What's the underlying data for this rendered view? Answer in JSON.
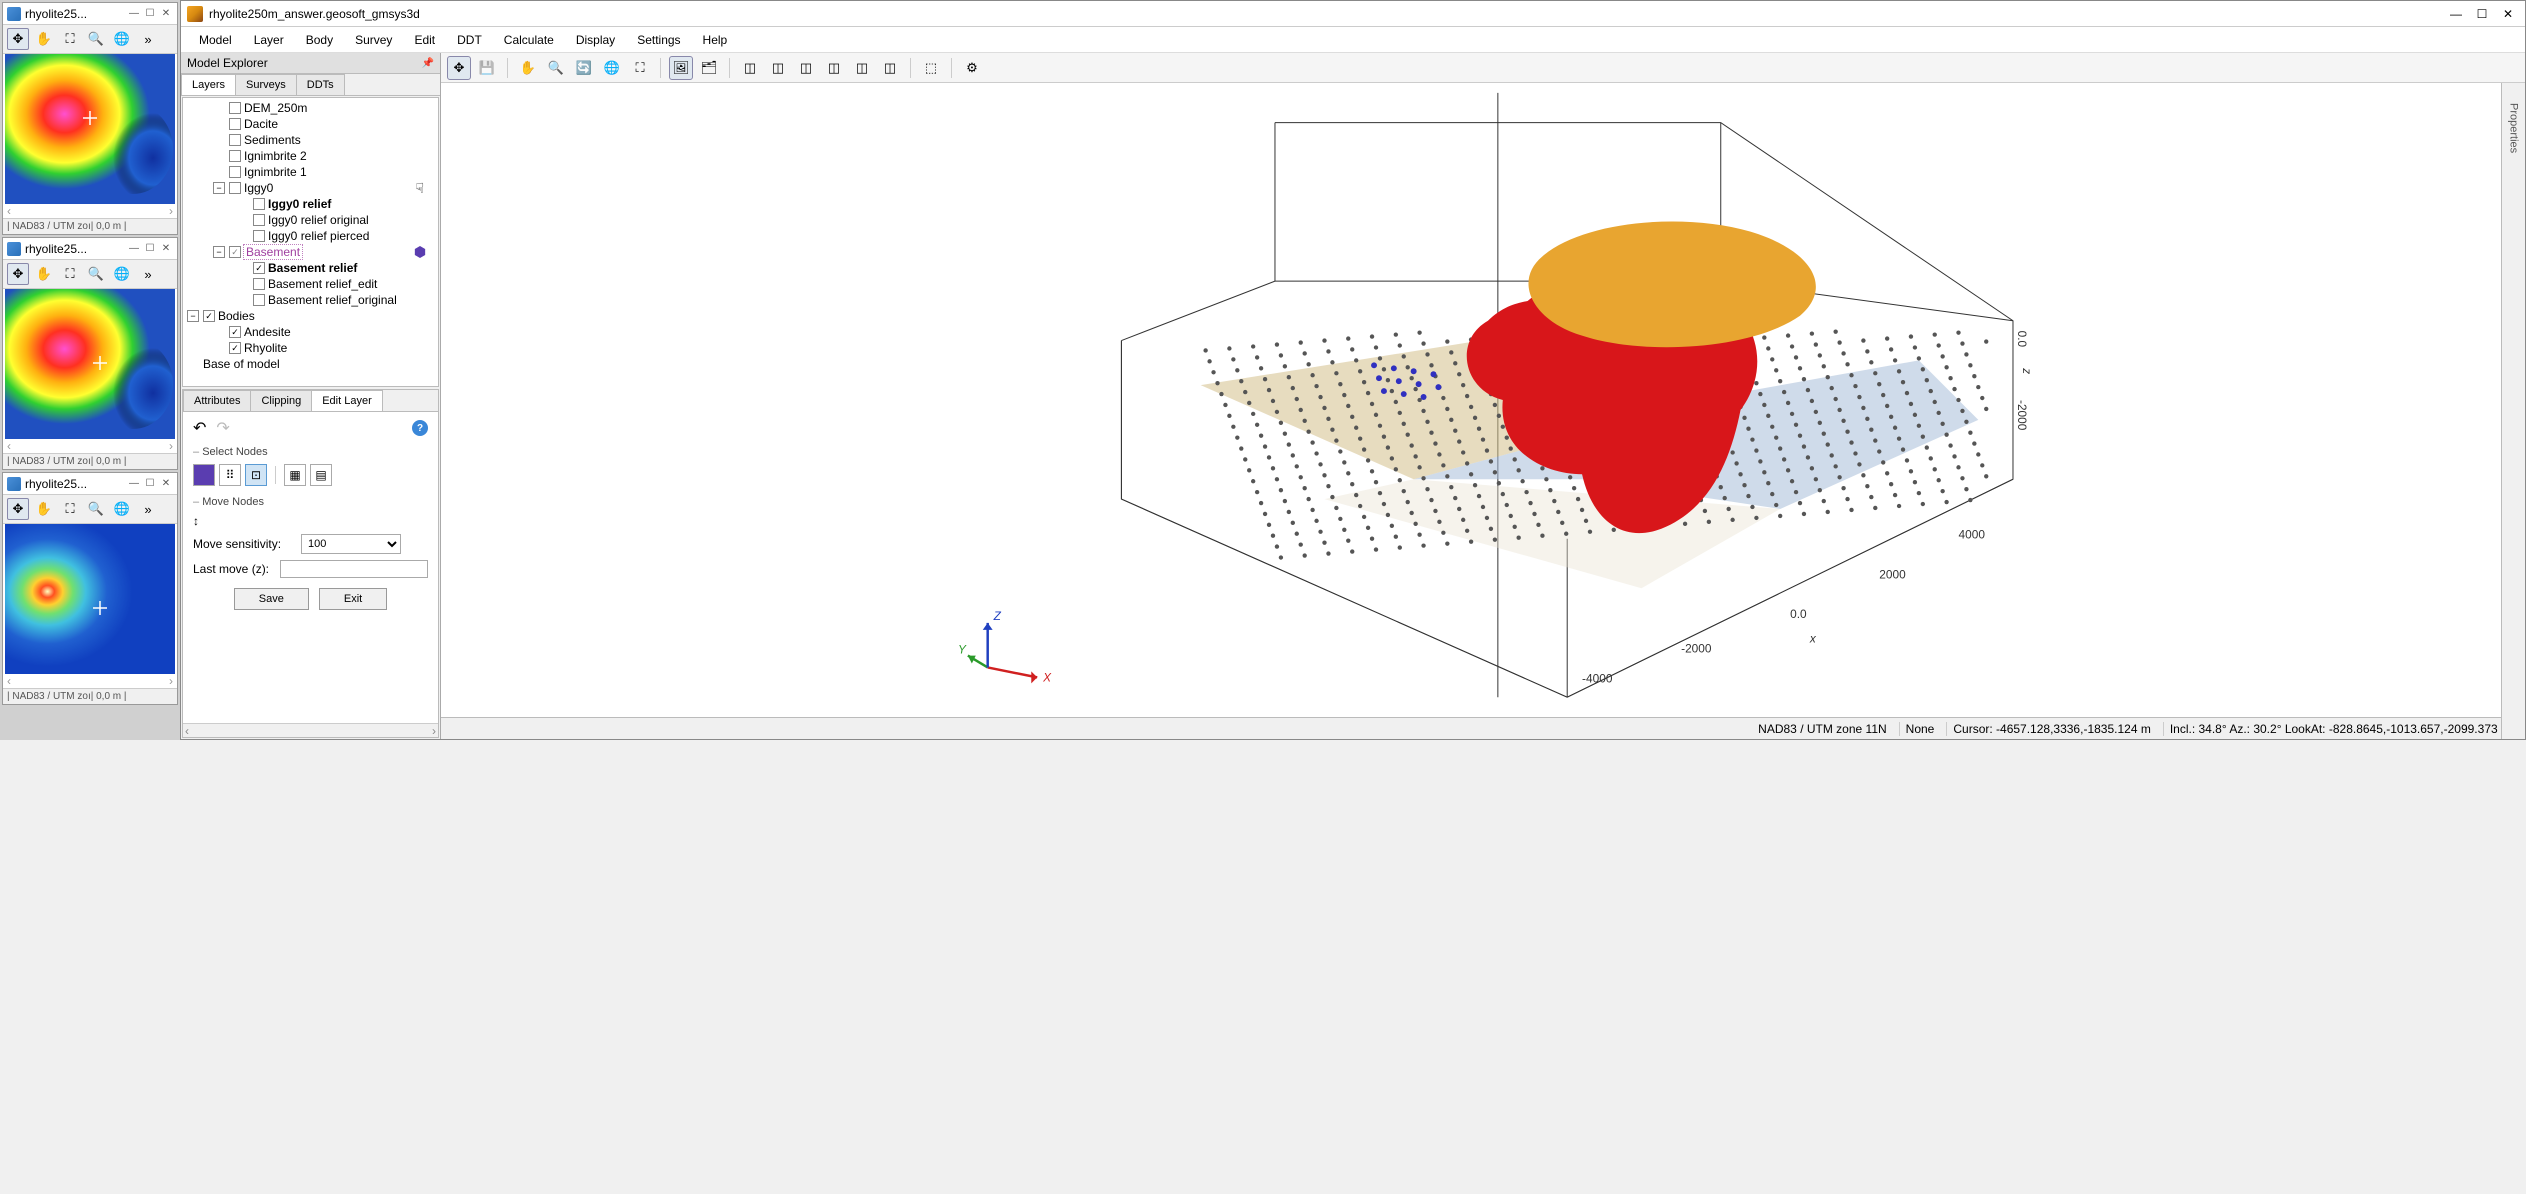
{
  "sidepanel": {
    "windows": [
      {
        "title": "rhyolite25...",
        "status": "| NAD83 / UTM zoı| 0,0 m |",
        "maptype": "rainbow"
      },
      {
        "title": "rhyolite25...",
        "status": "| NAD83 / UTM zoı| 0,0 m |",
        "maptype": "rainbow"
      },
      {
        "title": "rhyolite25...",
        "status": "| NAD83 / UTM zoı| 0,0 m |",
        "maptype": "bluespot"
      }
    ]
  },
  "main": {
    "title": "rhyolite250m_answer.geosoft_gmsys3d",
    "menu": [
      "Model",
      "Layer",
      "Body",
      "Survey",
      "Edit",
      "DDT",
      "Calculate",
      "Display",
      "Settings",
      "Help"
    ]
  },
  "explorer": {
    "header": "Model Explorer",
    "tabs": [
      "Layers",
      "Surveys",
      "DDTs"
    ],
    "activeTab": 0,
    "tree": {
      "dem": "DEM_250m",
      "dacite": "Dacite",
      "sediments": "Sediments",
      "ign2": "Ignimbrite 2",
      "ign1": "Ignimbrite 1",
      "iggy0": "Iggy0",
      "iggy0_relief": "Iggy0 relief",
      "iggy0_orig": "Iggy0 relief original",
      "iggy0_pierced": "Iggy0 relief pierced",
      "basement": "Basement",
      "basement_relief": "Basement relief",
      "basement_edit": "Basement relief_edit",
      "basement_orig": "Basement relief_original",
      "bodies": "Bodies",
      "andesite": "Andesite",
      "rhyolite": "Rhyolite",
      "base": "Base of model"
    }
  },
  "lower": {
    "tabs": [
      "Attributes",
      "Clipping",
      "Edit Layer"
    ],
    "activeTab": 2,
    "select_nodes": "Select Nodes",
    "move_nodes": "Move Nodes",
    "move_sens_label": "Move sensitivity:",
    "move_sens_value": "100",
    "last_move_label": "Last move (z):",
    "last_move_value": "",
    "save": "Save",
    "exit": "Exit"
  },
  "statusbar": {
    "projection": "NAD83 / UTM zone 11N",
    "units": "None",
    "cursor": "Cursor: -4657.128,3336,-1835.124 m",
    "view": "Incl.: 34.8° Az.: 30.2° LookAt: -828.8645,-1013.657,-2099.373 m"
  },
  "properties_tab": "Properties",
  "axes": {
    "x": "X",
    "y": "Y",
    "z": "Z",
    "xlabel": "x",
    "zlabel": "z"
  }
}
